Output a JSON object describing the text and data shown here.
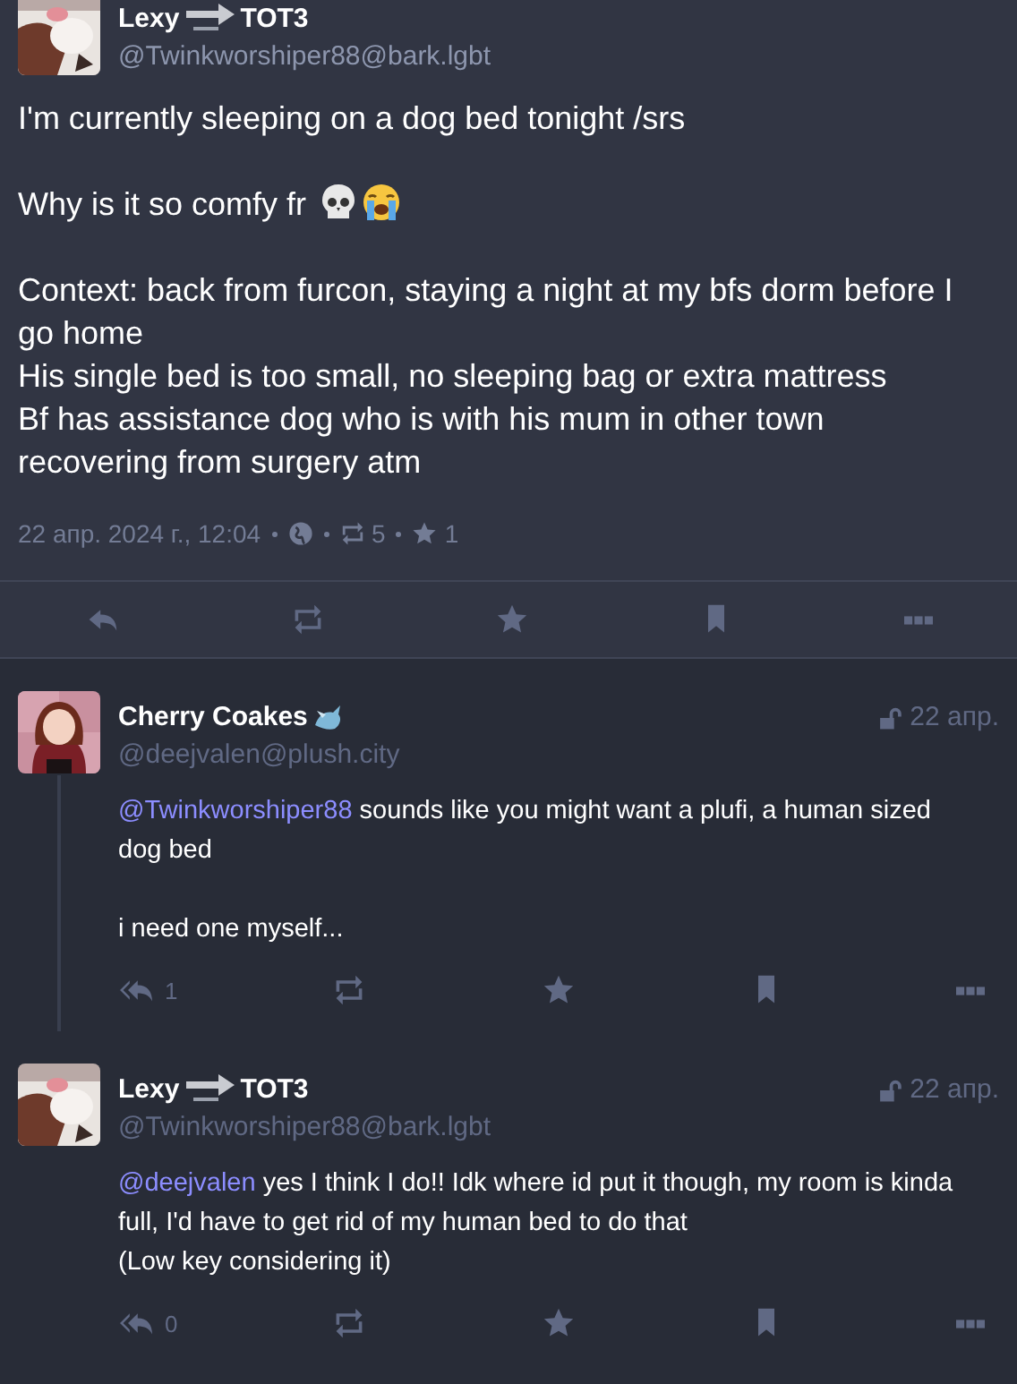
{
  "main_post": {
    "author": {
      "name_before": "Lexy",
      "name_after": "TOT3",
      "handle": "@Twinkworshiper88@bark.lgbt"
    },
    "paragraphs": [
      {
        "text": "I'm currently sleeping on a dog bed tonight /srs",
        "emoji": false
      },
      {
        "text": "Why is it so comfy fr",
        "emoji": true
      },
      {
        "text": "Context: back from furcon, staying a night at my bfs dorm before I go home\nHis single bed is too small, no sleeping bag or extra mattress\nBf has assistance dog who is with his mum in other town recovering from surgery atm",
        "emoji": false
      }
    ],
    "meta": {
      "date": "22 апр. 2024 г., 12:04",
      "boosts": "5",
      "favourites": "1"
    }
  },
  "replies": [
    {
      "author": {
        "name": "Cherry Coakes",
        "handle": "@deejvalen@plush.city",
        "kind": "badge"
      },
      "time": "22 апр.",
      "thread_line": true,
      "paragraphs": [
        {
          "mention": "@Twinkworshiper88",
          "text": " sounds like you might want a plufi, a human sized dog bed"
        },
        {
          "text": "i need one myself..."
        }
      ],
      "replies_count": "1"
    },
    {
      "author": {
        "name_before": "Lexy",
        "name_after": "TOT3",
        "handle": "@Twinkworshiper88@bark.lgbt",
        "kind": "arrow"
      },
      "time": "22 апр.",
      "thread_line": false,
      "paragraphs": [
        {
          "mention": "@deejvalen",
          "text": " yes I think I do!! Idk where id put it though, my room is kinda full, I'd have to get rid of my human bed to do that\n(Low key considering it)"
        }
      ],
      "replies_count": "0"
    }
  ]
}
